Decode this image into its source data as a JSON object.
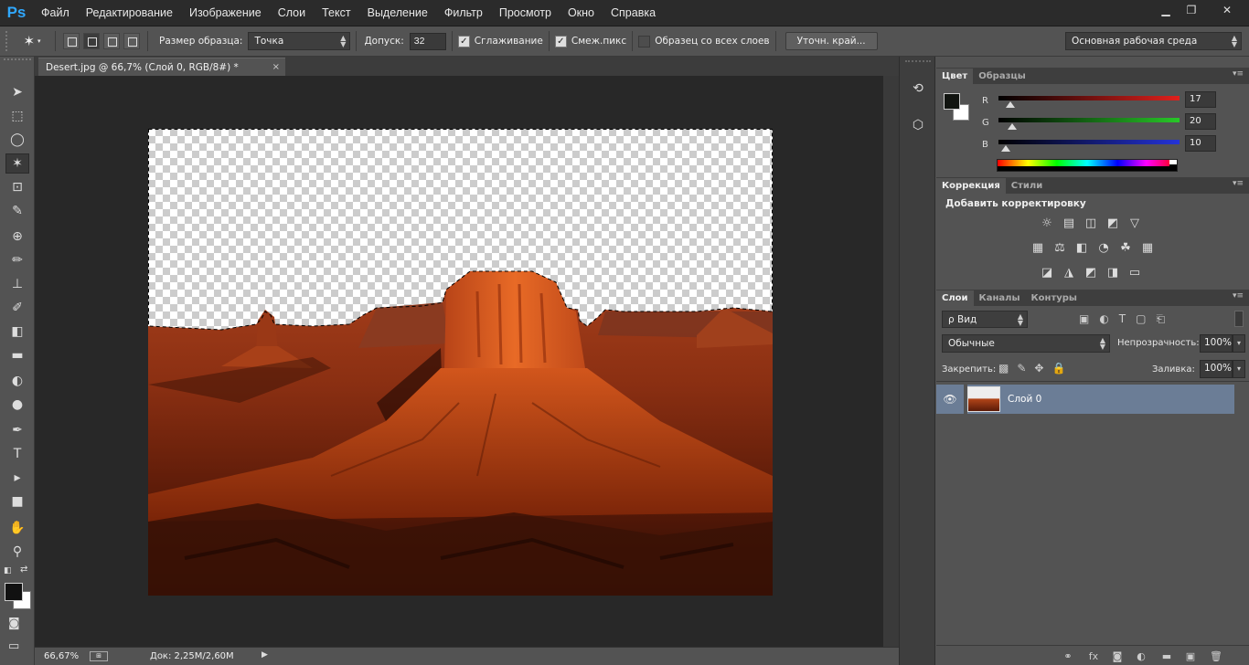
{
  "app": {
    "logo": "Ps"
  },
  "menu": [
    "Файл",
    "Редактирование",
    "Изображение",
    "Слои",
    "Текст",
    "Выделение",
    "Фильтр",
    "Просмотр",
    "Окно",
    "Справка"
  ],
  "window_controls": {
    "minimize": "▁",
    "restore": "❐",
    "close": "✕"
  },
  "options": {
    "sample_size_label": "Размер образца:",
    "sample_size_value": "Точка",
    "tolerance_label": "Допуск:",
    "tolerance_value": "32",
    "antialias_label": "Сглаживание",
    "antialias_checked": true,
    "contiguous_label": "Смеж.пикс",
    "contiguous_checked": true,
    "sample_all_label": "Образец со всех слоев",
    "sample_all_checked": false,
    "refine_edge_label": "Уточн. край...",
    "workspace_value": "Основная рабочая среда"
  },
  "document": {
    "tab_title": "Desert.jpg @ 66,7% (Слой 0, RGB/8#) *",
    "close_glyph": "×"
  },
  "status": {
    "zoom": "66,67%",
    "doc_info": "Док: 2,25M/2,60M"
  },
  "tools": [
    "move-tool",
    "marquee-tool",
    "lasso-tool",
    "magic-wand-tool",
    "crop-tool",
    "eyedropper-tool",
    "spot-healing-tool",
    "brush-tool",
    "clone-stamp-tool",
    "history-brush-tool",
    "eraser-tool",
    "gradient-tool",
    "blur-tool",
    "dodge-tool",
    "pen-tool",
    "type-tool",
    "path-selection-tool",
    "rectangle-tool",
    "hand-tool",
    "zoom-tool"
  ],
  "tool_glyphs": [
    "➤",
    "⬚",
    "◯",
    "✶",
    "⊡",
    "✎",
    "⊕",
    "✏",
    "⊥",
    "✐",
    "◧",
    "▬",
    "◐",
    "●",
    "✒",
    "T",
    "▸",
    "■",
    "✋",
    "⚲"
  ],
  "color_panel": {
    "tabs": [
      "Цвет",
      "Образцы"
    ],
    "channels": [
      {
        "label": "R",
        "value": "17",
        "fraction": 0.067,
        "color": "#e0201c"
      },
      {
        "label": "G",
        "value": "20",
        "fraction": 0.078,
        "color": "#28c828"
      },
      {
        "label": "B",
        "value": "10",
        "fraction": 0.039,
        "color": "#2433d8"
      }
    ],
    "foreground": "#111410",
    "background": "#ffffff"
  },
  "adjustments_panel": {
    "tabs": [
      "Коррекция",
      "Стили"
    ],
    "heading": "Добавить корректировку",
    "rows": [
      [
        "brightness-contrast-icon",
        "levels-icon",
        "curves-icon",
        "exposure-icon",
        "vibrance-icon"
      ],
      [
        "hue-saturation-icon",
        "color-balance-icon",
        "black-white-icon",
        "photo-filter-icon",
        "channel-mixer-icon",
        "color-lookup-icon"
      ],
      [
        "invert-icon",
        "posterize-icon",
        "threshold-icon",
        "selective-color-icon",
        "gradient-map-icon"
      ]
    ],
    "glyphs": [
      [
        "☼",
        "▤",
        "◫",
        "◩",
        "▽"
      ],
      [
        "▦",
        "⚖",
        "◧",
        "◔",
        "☘",
        "▦"
      ],
      [
        "◪",
        "◮",
        "◩",
        "◨",
        "▭"
      ]
    ]
  },
  "layers_panel": {
    "tabs": [
      "Слои",
      "Каналы",
      "Контуры"
    ],
    "filter_label": "ρ Вид",
    "blend_mode": "Обычные",
    "opacity_label": "Непрозрачность:",
    "opacity_value": "100%",
    "lock_label": "Закрепить:",
    "fill_label": "Заливка:",
    "fill_value": "100%",
    "layers": [
      {
        "name": "Слой 0",
        "visible": true
      }
    ],
    "bottom_icons": [
      "link-icon",
      "fx-icon",
      "mask-icon",
      "adjustment-layer-icon",
      "group-icon",
      "new-layer-icon",
      "trash-icon"
    ],
    "bottom_glyphs": [
      "⚭",
      "fx",
      "◙",
      "◐",
      "▬",
      "▣",
      "🗑"
    ]
  }
}
